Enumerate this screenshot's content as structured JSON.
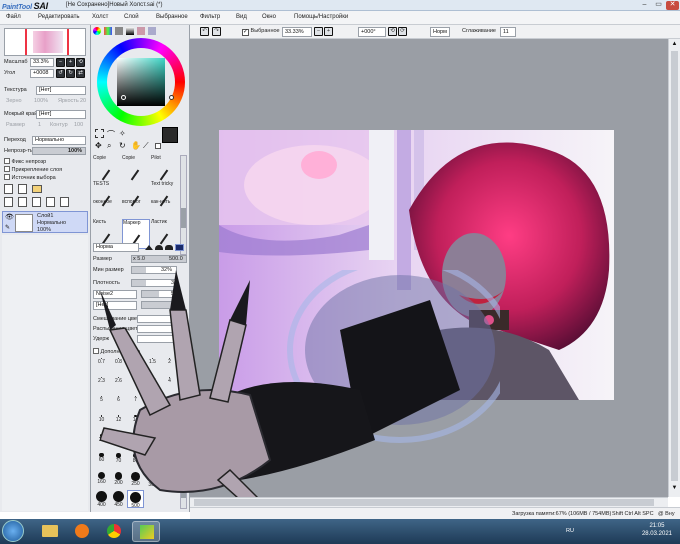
{
  "titlebar": {
    "app_name": "SAI",
    "app_prefix": "PaintTool",
    "title": "[Не Сохранено]Новый Холст.sai (*)"
  },
  "menu": {
    "file": "Файл",
    "edit": "Редактировать",
    "canvas": "Холст",
    "layer": "Слой",
    "selection": "Выбранное",
    "filter": "Фильтр",
    "view": "Вид",
    "window": "Окно",
    "settings": "Помощь/Настройки"
  },
  "canvas_toolbar": {
    "selection_label": "Выбранное",
    "zoom": "33.33%",
    "rotation": "+000°",
    "blend": "Норм",
    "smoothing_label": "Сглаживание",
    "smoothing_value": "11"
  },
  "navigator": {
    "scale_label": "Масштаб",
    "scale_value": "33.3%",
    "angle_label": "Угол",
    "angle_value": "+0008"
  },
  "layer_props": {
    "texture_label": "Текстура",
    "texture_value": "[Нет]",
    "scale_label": "Зерно",
    "scale_value": "100%",
    "intensity_label": "Яркость",
    "intensity_value": "20",
    "wet_edge_label": "Мокрый край",
    "wet_edge_value": "[Нет]",
    "wet_size_label": "Размер",
    "wet_size_value": "1",
    "wet_strength_label": "Контур",
    "wet_strength_value": "100",
    "blend_label": "Переход",
    "blend_value": "Нормально",
    "opacity_label": "Непрозр-ть",
    "opacity_value": "100%",
    "fix_opacity": "Фикс непрозр",
    "clip_layer": "Прикрепление слоя",
    "selection_source": "Источник выбора"
  },
  "layer": {
    "name": "Слой1",
    "mode": "Нормально",
    "opacity": "100%"
  },
  "tools": {
    "row1": [
      "Copie",
      "Copie",
      "Pilot"
    ],
    "row2": [
      "TESTS",
      "",
      "Text tricky"
    ],
    "row3": [
      "оконное",
      "вспомог",
      "как-нить"
    ],
    "row4": [
      "Кисть",
      "Маркер",
      "Ластик"
    ]
  },
  "brush": {
    "mode": "Норма",
    "size_label": "Размер",
    "size_mult": "x 5.0",
    "size_value": "500.0",
    "min_size_label": "Мин размер",
    "min_size_value": "32%",
    "density_label": "Плотность",
    "density_value": "31",
    "shape_value": "Noise2",
    "shape_strength": "50",
    "texture_value": "[Нет]",
    "texture_strength": "95",
    "blend_label": "Смешивание цвет",
    "dilution_label": "Распыление цвет",
    "persistence_label": "Удерж",
    "advanced_label": "Дополнительно"
  },
  "brush_sizes": [
    "0.7",
    "0.8",
    "1",
    "1.5",
    "2",
    "2.3",
    "2.6",
    "3",
    "3.5",
    "4",
    "5",
    "6",
    "7",
    "8",
    "9",
    "10",
    "12",
    "14",
    "16",
    "20",
    "25",
    "30",
    "35",
    "40",
    "50",
    "60",
    "70",
    "80",
    "100",
    "120",
    "160",
    "200",
    "250",
    "300",
    "350",
    "400",
    "450",
    "500"
  ],
  "selected_brush_size": "500",
  "status": {
    "memory": "Загрузка памяти:67% (106MB / 754MB)",
    "keys": "Shift Ctrl Alt SPC",
    "fps": "@ Вну"
  },
  "taskbar": {
    "lang": "RU",
    "time": "21:05",
    "date": "28.03.2021"
  },
  "colors": {
    "accent": "#7f95d4",
    "current_color": "#2a2a2a"
  }
}
